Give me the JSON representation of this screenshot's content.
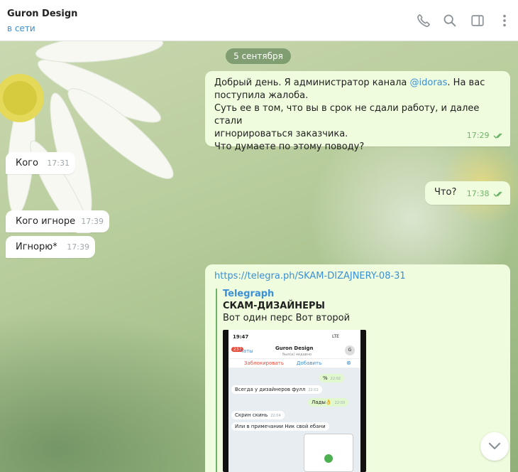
{
  "header": {
    "title": "Guron Design",
    "status": "в сети",
    "icons": [
      "phone-icon",
      "search-icon",
      "sidebar-toggle-icon",
      "more-vertical-icon"
    ]
  },
  "date_separator": "5 сентября",
  "messages": [
    {
      "direction": "out",
      "text_before": "Добрый день. Я администратор канала ",
      "mention": "@idoras",
      "text_after": ". На вас\nпоступила жалоба.\nСуть ее в том, что вы в срок не сдали работу, и далее стали\nигнорироваться заказчика.\nЧто думаете по этому поводу?",
      "time": "17:29",
      "read": true
    },
    {
      "direction": "in",
      "text": "Кого",
      "time": "17:31"
    },
    {
      "direction": "out",
      "text": "Что?",
      "time": "17:38",
      "read": true
    },
    {
      "direction": "in",
      "text": "Кого игноре",
      "time": "17:39"
    },
    {
      "direction": "in",
      "text": "Игнорю*",
      "time": "17:39"
    },
    {
      "direction": "out",
      "link": "https://telegra.ph/SKAM-DIZAJNERY-08-31",
      "preview": {
        "site": "Telegraph",
        "title": "СКАМ-ДИЗАЙНЕРЫ",
        "description": "Вот один перс Вот второй",
        "screenshot": {
          "time": "19:47",
          "signal": "LTE",
          "back_badge": "237",
          "back_label": "Чаты",
          "contact": "Guron Design",
          "contact_status": "был(а) недавно",
          "avatar_letter": "G",
          "block_label": "Заблокировать",
          "add_label": "Добавить",
          "bubbles": [
            {
              "side": "out",
              "text": "%",
              "time": "22:02"
            },
            {
              "side": "in",
              "text": "Всегда у дизайнеров фулл",
              "time": "22:02"
            },
            {
              "side": "out",
              "text": "Лады👌",
              "time": "22:03"
            },
            {
              "side": "in",
              "text": "Скрин скинь",
              "time": "22:04"
            },
            {
              "side": "in",
              "text": "Или в примечании Ник свой ебани",
              "time": ""
            }
          ]
        }
      }
    }
  ],
  "colors": {
    "outgoing_bubble": "#effdde",
    "incoming_bubble": "#ffffff",
    "accent": "#3a8fd6",
    "read_check": "#6fb36a"
  }
}
